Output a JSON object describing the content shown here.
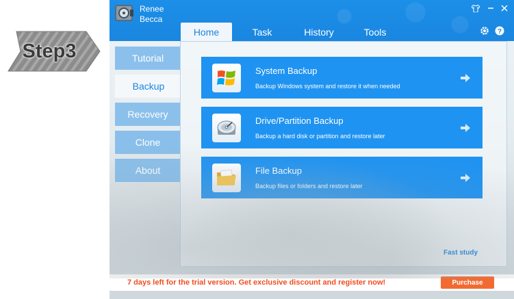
{
  "step": {
    "label": "Step3"
  },
  "app": {
    "name_line1": "Renee",
    "name_line2": "Becca"
  },
  "tabs": [
    {
      "label": "Home",
      "active": true
    },
    {
      "label": "Task"
    },
    {
      "label": "History"
    },
    {
      "label": "Tools"
    }
  ],
  "sidebar": {
    "items": [
      {
        "label": "Tutorial"
      },
      {
        "label": "Backup",
        "active": true
      },
      {
        "label": "Recovery"
      },
      {
        "label": "Clone"
      },
      {
        "label": "About"
      }
    ]
  },
  "cards": [
    {
      "title": "System Backup",
      "desc": "Backup Windows system and restore it when needed",
      "icon": "windows-logo-icon"
    },
    {
      "title": "Drive/Partition Backup",
      "desc": "Backup a hard disk or partition and restore later",
      "icon": "hard-disk-icon"
    },
    {
      "title": "File Backup",
      "desc": "Backup files or folders and restore later",
      "icon": "folder-icon"
    }
  ],
  "fast_study": "Fast study",
  "trial": {
    "message": "7 days left for the trial version. Get exclusive discount and register now!",
    "purchase_label": "Purchase"
  },
  "colors": {
    "accent": "#1a86e0",
    "card": "#1f93f1",
    "trial_text": "#f04d1f",
    "purchase": "#f26a32"
  }
}
